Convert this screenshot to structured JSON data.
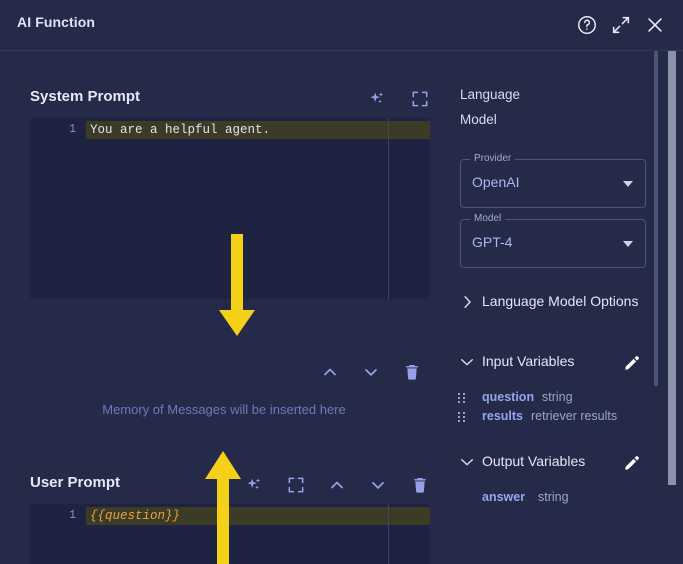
{
  "window": {
    "title": "AI Function",
    "icons": {
      "help": "help-circle-icon",
      "expand": "expand-diagonal-icon",
      "close": "close-icon"
    }
  },
  "system_prompt": {
    "title": "System Prompt",
    "icons": [
      "sparkle-icon",
      "fullscreen-icon"
    ],
    "editor": {
      "lines": [
        {
          "number": "1",
          "text": "You are a helpful agent."
        }
      ]
    }
  },
  "prompt_toolbar": {
    "move_up": "⌃",
    "move_down": "⌄",
    "delete": "trash-icon"
  },
  "memory_note": "Memory of Messages will be inserted here",
  "user_prompt": {
    "title": "User Prompt",
    "icons": [
      "sparkle-icon",
      "fullscreen-icon",
      "chevron-up-icon",
      "chevron-down-icon",
      "trash-icon"
    ],
    "editor": {
      "lines": [
        {
          "number": "1",
          "text": "{{question}}"
        }
      ]
    }
  },
  "right_panel": {
    "heading_line1": "Language",
    "heading_line2": "Model",
    "provider": {
      "legend": "Provider",
      "value": "OpenAI"
    },
    "model": {
      "legend": "Model",
      "value": "GPT-4"
    },
    "language_model_options": {
      "label": "Language Model Options",
      "expanded": false
    },
    "input_variables": {
      "label": "Input Variables",
      "expanded": true,
      "items": [
        {
          "name": "question",
          "type": "string"
        },
        {
          "name": "results",
          "type": "retriever results"
        }
      ]
    },
    "output_variables": {
      "label": "Output Variables",
      "expanded": true,
      "items": [
        {
          "name": "answer",
          "type": "string"
        }
      ]
    }
  },
  "colors": {
    "panel_bg": "#242a47",
    "editor_bg": "#1d2340",
    "active_line": "#3c3b26",
    "accent_purple": "#9aa0e8",
    "variable_blue": "#92a6ef",
    "annotation_yellow": "#f5d019",
    "template_orange": "#e8a33d"
  }
}
